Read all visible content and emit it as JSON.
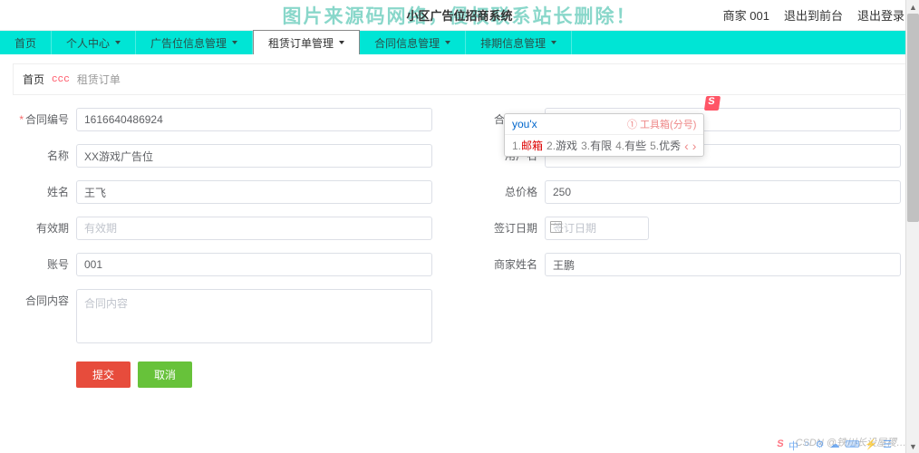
{
  "header": {
    "system_title": "小区广告位招商系统",
    "watermark_text": "图片来源码网络，侵权联系站长删除！",
    "user_label": "商家 001",
    "exit_front": "退出到前台",
    "logout": "退出登录"
  },
  "nav": {
    "items": [
      {
        "label": "首页",
        "caret": false
      },
      {
        "label": "个人中心",
        "caret": true
      },
      {
        "label": "广告位信息管理",
        "caret": true
      },
      {
        "label": "租赁订单管理",
        "caret": true
      },
      {
        "label": "合同信息管理",
        "caret": true
      },
      {
        "label": "排期信息管理",
        "caret": true
      }
    ],
    "active_index": 3
  },
  "breadcrumb": {
    "home": "首页",
    "icon": "ccc",
    "current": "租赁订单"
  },
  "form": {
    "left": {
      "contract_no": {
        "label": "合同编号",
        "value": "1616640486924"
      },
      "name": {
        "label": "名称",
        "value": "XX游戏广告位"
      },
      "surname": {
        "label": "姓名",
        "value": "王飞"
      },
      "validity": {
        "label": "有效期",
        "placeholder": "有效期",
        "value": ""
      },
      "account": {
        "label": "账号",
        "value": "001"
      },
      "content": {
        "label": "合同内容",
        "placeholder": "合同内容",
        "value": ""
      }
    },
    "right": {
      "contract_name": {
        "label": "合同名称",
        "value": "youx"
      },
      "user_name": {
        "label": "用户名",
        "value": ""
      },
      "total_price": {
        "label": "总价格",
        "value": "250"
      },
      "sign_date": {
        "label": "签订日期",
        "placeholder": "签订日期",
        "value": ""
      },
      "merchant_name": {
        "label": "商家姓名",
        "value": "王鹏"
      }
    }
  },
  "buttons": {
    "submit": "提交",
    "cancel": "取消"
  },
  "ime": {
    "typed": "you'x",
    "toolbox": "① 工具箱(分号)",
    "candidates": [
      {
        "n": "1.",
        "t": "邮箱"
      },
      {
        "n": "2.",
        "t": "游戏"
      },
      {
        "n": "3.",
        "t": "有限"
      },
      {
        "n": "4.",
        "t": "有些"
      },
      {
        "n": "5.",
        "t": "优秀"
      }
    ],
    "more": "‹ ›"
  },
  "footer": {
    "csdn_wm": "CSDN @铁川长设屋稷…",
    "tray": [
      "中",
      "○",
      "⚙",
      "☁",
      "⌨",
      "⚡",
      "☰"
    ]
  }
}
